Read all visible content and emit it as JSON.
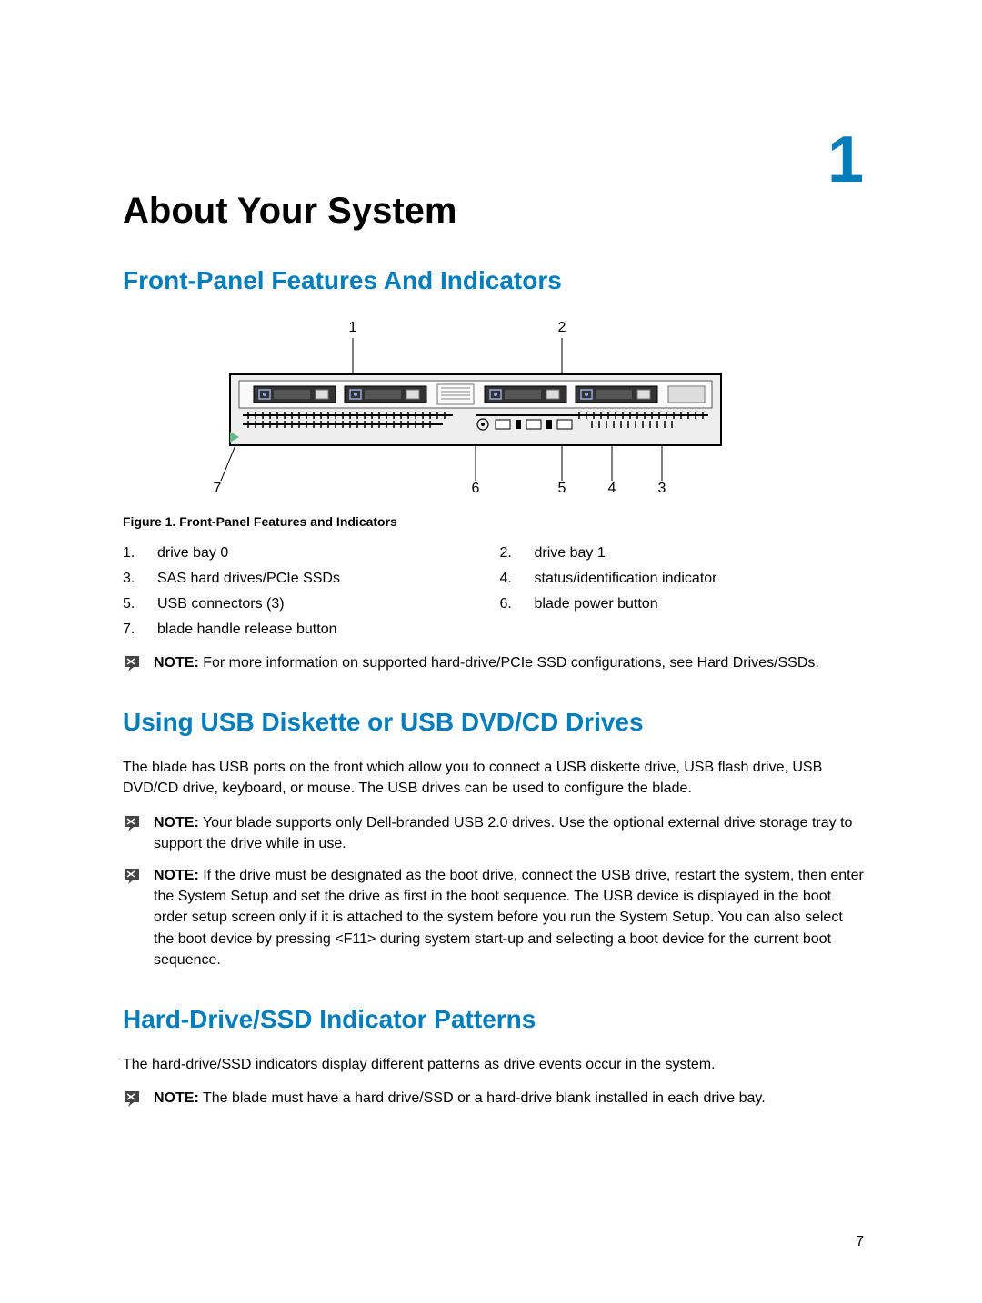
{
  "chapter_number": "1",
  "page_number": "7",
  "h1": "About Your System",
  "sections": {
    "front_panel": {
      "heading": "Front-Panel Features And Indicators",
      "figure_caption": "Figure 1. Front-Panel Features and Indicators",
      "callouts": [
        {
          "n": "1.",
          "t": "drive bay 0"
        },
        {
          "n": "2.",
          "t": "drive bay 1"
        },
        {
          "n": "3.",
          "t": "SAS hard drives/PCIe SSDs"
        },
        {
          "n": "4.",
          "t": "status/identification indicator"
        },
        {
          "n": "5.",
          "t": "USB connectors (3)"
        },
        {
          "n": "6.",
          "t": "blade power button"
        },
        {
          "n": "7.",
          "t": "blade handle release button"
        }
      ],
      "note": {
        "label": "NOTE:",
        "text": " For more information on supported hard-drive/PCIe SSD configurations, see Hard Drives/SSDs."
      }
    },
    "usb": {
      "heading": "Using USB Diskette or USB DVD/CD Drives",
      "body": "The blade has USB ports on the front which allow you to connect a USB diskette drive, USB flash drive, USB DVD/CD drive, keyboard, or mouse. The USB drives can be used to configure the blade.",
      "note1": {
        "label": "NOTE:",
        "text": " Your blade supports only Dell-branded USB 2.0 drives. Use the optional external drive storage tray to support the drive while in use."
      },
      "note2": {
        "label": "NOTE:",
        "text": " If the drive must be designated as the boot drive, connect the USB drive, restart the system, then enter the System Setup and set the drive as first in the boot sequence. The USB device is displayed in the boot order setup screen only if it is attached to the system before you run the System Setup. You can also select the boot device by pressing <F11> during system start-up and selecting a boot device for the current boot sequence."
      }
    },
    "hdd": {
      "heading": "Hard-Drive/SSD Indicator Patterns",
      "body": "The hard-drive/SSD indicators display different patterns as drive events occur in the system.",
      "note": {
        "label": "NOTE:",
        "text": " The blade must have a hard drive/SSD or a hard-drive blank installed in each drive bay."
      }
    }
  },
  "figure_callout_labels": [
    "1",
    "2",
    "3",
    "4",
    "5",
    "6",
    "7"
  ]
}
